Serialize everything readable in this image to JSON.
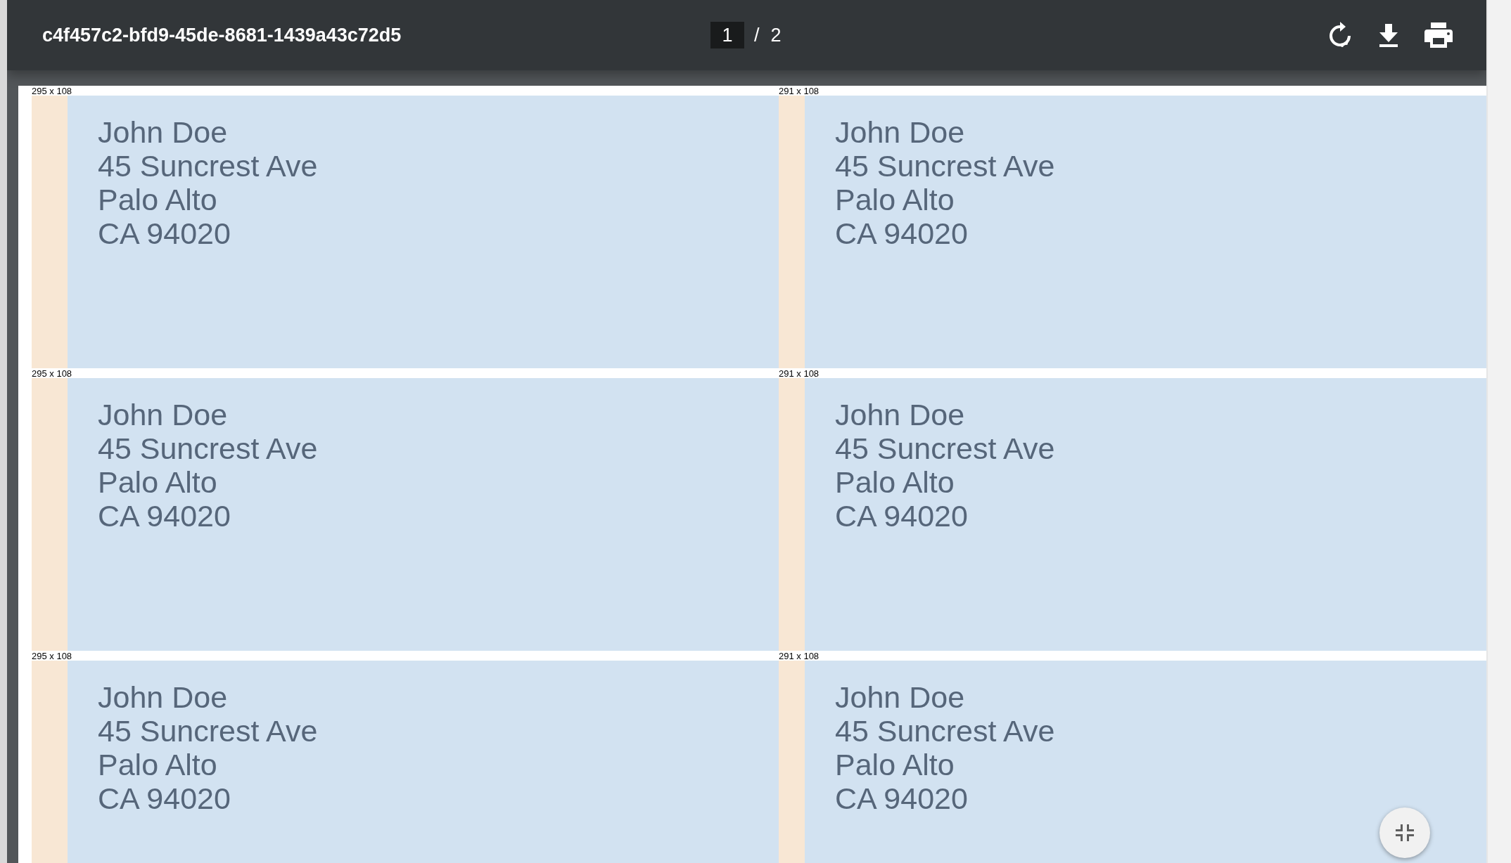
{
  "toolbar": {
    "title": "c4f457c2-bfd9-45de-8681-1439a43c72d5",
    "page_current": "1",
    "page_separator": "/",
    "page_total": "2"
  },
  "labels": [
    {
      "size": "295 x 108",
      "lines": [
        "John Doe",
        "45 Suncrest Ave",
        "Palo Alto",
        "CA 94020"
      ]
    },
    {
      "size": "291 x 108",
      "lines": [
        "John Doe",
        "45 Suncrest Ave",
        "Palo Alto",
        "CA 94020"
      ]
    },
    {
      "size": "295 x 108",
      "lines": [
        "John Doe",
        "45 Suncrest Ave",
        "Palo Alto",
        "CA 94020"
      ]
    },
    {
      "size": "291 x 108",
      "lines": [
        "John Doe",
        "45 Suncrest Ave",
        "Palo Alto",
        "CA 94020"
      ]
    },
    {
      "size": "295 x 108",
      "lines": [
        "John Doe",
        "45 Suncrest Ave",
        "Palo Alto",
        "CA 94020"
      ]
    },
    {
      "size": "291 x 108",
      "lines": [
        "John Doe",
        "45 Suncrest Ave",
        "Palo Alto",
        "CA 94020"
      ]
    }
  ]
}
